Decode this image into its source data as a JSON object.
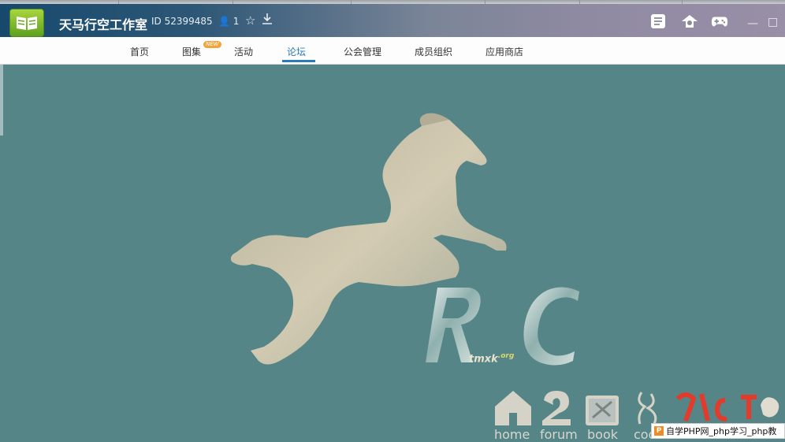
{
  "window": {
    "title": "天马行空工作室",
    "group_id": "ID 52399485",
    "member_count": "1",
    "icons": [
      "star-icon",
      "download-icon",
      "message-box-icon",
      "share-icon",
      "gamepad-icon",
      "minimize-icon",
      "maximize-icon"
    ]
  },
  "nav": {
    "items": [
      {
        "label": "首页"
      },
      {
        "label": "图集",
        "badge": "NEW"
      },
      {
        "label": "活动"
      },
      {
        "label": "论坛",
        "active": true
      },
      {
        "label": "公会管理"
      },
      {
        "label": "成员组织"
      },
      {
        "label": "应用商店"
      }
    ]
  },
  "content": {
    "logo_tag": "tmxk",
    "logo_tag_suffix": ".org",
    "links": [
      {
        "label": "home"
      },
      {
        "label": "forum"
      },
      {
        "label": "book"
      },
      {
        "label": "code"
      }
    ]
  },
  "watermark": {
    "text": "自学PHP网_php学习_php教"
  },
  "colors": {
    "stage_bg": "#558586",
    "active_tab": "#2b79b5",
    "horse": "#c9c2a8"
  }
}
